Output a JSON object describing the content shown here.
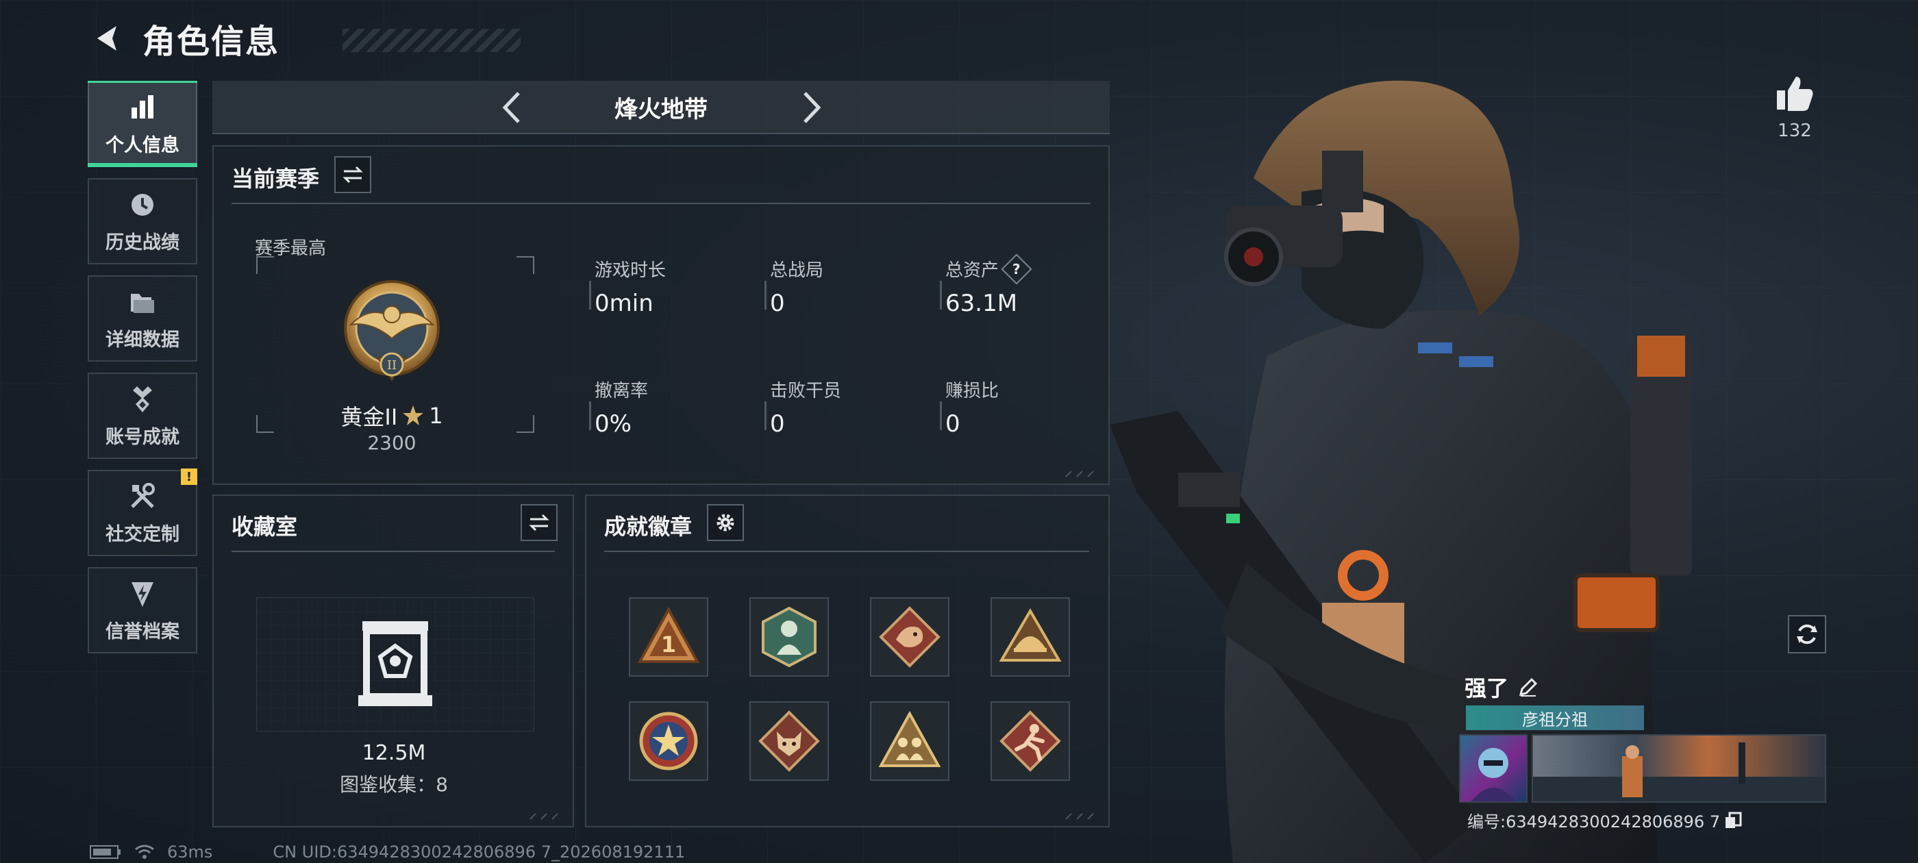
{
  "header": {
    "title": "角色信息"
  },
  "sidebar": {
    "items": [
      {
        "label": "个人信息",
        "icon": "bar-chart-icon",
        "active": true
      },
      {
        "label": "历史战绩",
        "icon": "clock-icon"
      },
      {
        "label": "详细数据",
        "icon": "folder-icon"
      },
      {
        "label": "账号成就",
        "icon": "medal-icon"
      },
      {
        "label": "社交定制",
        "icon": "tools-icon",
        "badge": "!"
      },
      {
        "label": "信誉档案",
        "icon": "shield-bolt-icon"
      }
    ]
  },
  "mode": {
    "name": "烽火地带"
  },
  "season": {
    "title": "当前赛季",
    "subtitle": "赛季最高",
    "rank_name": "黄金II",
    "rank_stars": "1",
    "rank_score": "2300",
    "stats": [
      {
        "label": "游戏时长",
        "value": "0min"
      },
      {
        "label": "总战局",
        "value": "0"
      },
      {
        "label": "总资产",
        "value": "63.1M",
        "help": "?"
      },
      {
        "label": "撤离率",
        "value": "0%"
      },
      {
        "label": "击败干员",
        "value": "0"
      },
      {
        "label": "赚损比",
        "value": "0"
      }
    ]
  },
  "collection": {
    "title": "收藏室",
    "value": "12.5M",
    "count_text": "图鉴收集：8"
  },
  "achievements": {
    "title": "成就徽章",
    "badges": [
      "badge-rank-1",
      "badge-soldier",
      "badge-dragon",
      "badge-helmet",
      "badge-star",
      "badge-wolf",
      "badge-squad",
      "badge-runner"
    ]
  },
  "profile": {
    "likes": "132",
    "player_name": "强了",
    "title_tag": "彦祖分祖",
    "uid_text": "编号:6349428300242806896 7"
  },
  "status": {
    "ping": "63ms",
    "cn_uid": "CN UID:6349428300242806896 7_202608192111"
  },
  "colors": {
    "accent": "#3fd59a",
    "badge_warn": "#f5c542"
  }
}
